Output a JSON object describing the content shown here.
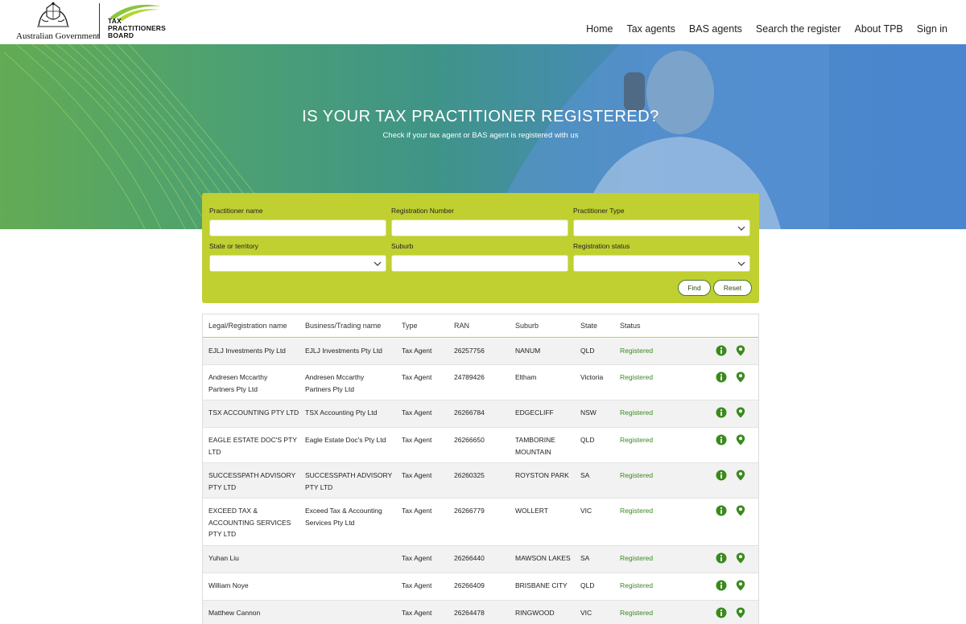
{
  "header": {
    "gov_text": "Australian Government",
    "tpb_lines": [
      "TAX",
      "PRACTITIONERS",
      "BOARD"
    ],
    "nav": [
      "Home",
      "Tax agents",
      "BAS agents",
      "Search the register",
      "About TPB",
      "Sign in"
    ]
  },
  "hero": {
    "title": "IS YOUR TAX PRACTITIONER REGISTERED?",
    "subtitle": "Check if your tax agent or BAS agent is registered with us"
  },
  "search": {
    "practitioner_name": {
      "label": "Practitioner name",
      "value": ""
    },
    "registration_number": {
      "label": "Registration Number",
      "value": ""
    },
    "practitioner_type": {
      "label": "Practitioner Type",
      "value": ""
    },
    "state": {
      "label": "State or territory",
      "value": ""
    },
    "suburb": {
      "label": "Suburb",
      "value": ""
    },
    "registration_status": {
      "label": "Registration status",
      "value": ""
    },
    "find_label": "Find",
    "reset_label": "Reset"
  },
  "table": {
    "columns": [
      "Legal/Registration name",
      "Business/Trading name",
      "Type",
      "RAN",
      "Suburb",
      "State",
      "Status"
    ],
    "rows": [
      {
        "legal": [
          "EJLJ Investments Pty Ltd"
        ],
        "business": [
          "EJLJ Investments Pty Ltd"
        ],
        "type": "Tax Agent",
        "ran": "26257756",
        "suburb": [
          "NANUM"
        ],
        "state": "QLD",
        "status": "Registered"
      },
      {
        "legal": [
          "Andresen Mccarthy",
          "Partners Pty Ltd"
        ],
        "business": [
          "Andresen Mccarthy",
          "Partners Pty Ltd"
        ],
        "type": "Tax Agent",
        "ran": "24789426",
        "suburb": [
          "Eltham"
        ],
        "state": "Victoria",
        "status": "Registered"
      },
      {
        "legal": [
          "TSX ACCOUNTING PTY LTD"
        ],
        "business": [
          "TSX Accounting Pty Ltd"
        ],
        "type": "Tax Agent",
        "ran": "26266784",
        "suburb": [
          "EDGECLIFF"
        ],
        "state": "NSW",
        "status": "Registered"
      },
      {
        "legal": [
          "EAGLE ESTATE DOC'S PTY",
          "LTD"
        ],
        "business": [
          "Eagle Estate Doc's Pty Ltd"
        ],
        "type": "Tax Agent",
        "ran": "26266650",
        "suburb": [
          "TAMBORINE",
          "MOUNTAIN"
        ],
        "state": "QLD",
        "status": "Registered"
      },
      {
        "legal": [
          "SUCCESSPATH ADVISORY",
          "PTY LTD"
        ],
        "business": [
          "SUCCESSPATH ADVISORY",
          "PTY LTD"
        ],
        "type": "Tax Agent",
        "ran": "26260325",
        "suburb": [
          "ROYSTON PARK"
        ],
        "state": "SA",
        "status": "Registered"
      },
      {
        "legal": [
          "EXCEED TAX &",
          "ACCOUNTING SERVICES",
          "PTY LTD"
        ],
        "business": [
          "Exceed Tax & Accounting",
          "Services Pty Ltd"
        ],
        "type": "Tax Agent",
        "ran": "26266779",
        "suburb": [
          "WOLLERT"
        ],
        "state": "VIC",
        "status": "Registered"
      },
      {
        "legal": [
          "Yuhan Liu"
        ],
        "business": [
          ""
        ],
        "type": "Tax Agent",
        "ran": "26266440",
        "suburb": [
          "MAWSON LAKES"
        ],
        "state": "SA",
        "status": "Registered"
      },
      {
        "legal": [
          "William Noye"
        ],
        "business": [
          ""
        ],
        "type": "Tax Agent",
        "ran": "26266409",
        "suburb": [
          "BRISBANE CITY"
        ],
        "state": "QLD",
        "status": "Registered"
      },
      {
        "legal": [
          "Matthew Cannon"
        ],
        "business": [
          ""
        ],
        "type": "Tax Agent",
        "ran": "26264478",
        "suburb": [
          "RINGWOOD"
        ],
        "state": "VIC",
        "status": "Registered"
      }
    ],
    "row_icons": [
      "info-icon",
      "location-pin-icon"
    ]
  },
  "colors": {
    "panel": "#bfd030",
    "status": "#3a8a1e",
    "icon": "#3a8a1e"
  }
}
